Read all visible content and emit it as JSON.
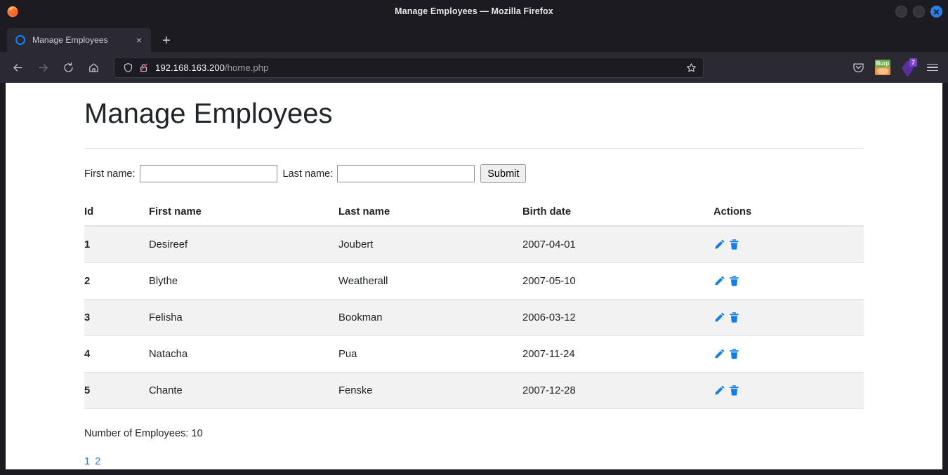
{
  "window": {
    "title": "Manage Employees — Mozilla Firefox",
    "controls": {
      "minimize": "minimize",
      "maximize": "maximize",
      "close": "close"
    }
  },
  "browser": {
    "tab": {
      "label": "Manage Employees",
      "close_label": "×",
      "favicon": "circle-favicon"
    },
    "new_tab_label": "+",
    "nav": {
      "back": "back-icon",
      "forward": "forward-icon",
      "reload": "reload-icon",
      "home": "home-icon"
    },
    "url": {
      "host": "192.168.163.200",
      "path": "/home.php",
      "shield_icon": "shield-icon",
      "lock_icon": "lock-crossed-icon",
      "bookmark_icon": "star-icon"
    },
    "toolbar": {
      "pocket": "pocket-icon",
      "burp_label": "Burp",
      "badge_count": "7",
      "menu": "hamburger-icon"
    }
  },
  "page": {
    "heading": "Manage Employees",
    "form": {
      "first_name_label": "First name:",
      "first_name_value": "",
      "first_name_placeholder": "",
      "last_name_label": "Last name:",
      "last_name_value": "",
      "last_name_placeholder": "",
      "submit_label": "Submit"
    },
    "table": {
      "columns": [
        "Id",
        "First name",
        "Last name",
        "Birth date",
        "Actions"
      ],
      "rows": [
        {
          "id": "1",
          "first_name": "Desireef",
          "last_name": "Joubert",
          "birth_date": "2007-04-01",
          "edit": "pencil-icon",
          "delete": "trash-icon"
        },
        {
          "id": "2",
          "first_name": "Blythe",
          "last_name": "Weatherall",
          "birth_date": "2007-05-10",
          "edit": "pencil-icon",
          "delete": "trash-icon"
        },
        {
          "id": "3",
          "first_name": "Felisha",
          "last_name": "Bookman",
          "birth_date": "2006-03-12",
          "edit": "pencil-icon",
          "delete": "trash-icon"
        },
        {
          "id": "4",
          "first_name": "Natacha",
          "last_name": "Pua",
          "birth_date": "2007-11-24",
          "edit": "pencil-icon",
          "delete": "trash-icon"
        },
        {
          "id": "5",
          "first_name": "Chante",
          "last_name": "Fenske",
          "birth_date": "2007-12-28",
          "edit": "pencil-icon",
          "delete": "trash-icon"
        }
      ]
    },
    "employee_count_text": "Number of Employees: 10",
    "pagination": [
      "1",
      "2"
    ]
  },
  "colors": {
    "chrome_bg": "#1c1b22",
    "tab_active": "#2b2a33",
    "accent_blue": "#0a84ff",
    "link_blue": "#2a7ae2",
    "action_icon": "#0d7ff2",
    "row_stripe": "#f2f2f2",
    "text_dark": "#212529"
  }
}
